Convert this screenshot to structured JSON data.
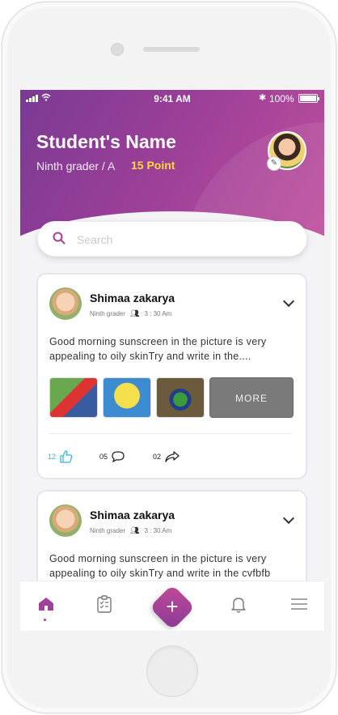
{
  "status_bar": {
    "time": "9:41 AM",
    "battery": "100%"
  },
  "profile": {
    "name": "Student's Name",
    "grade": "Ninth grader / A",
    "points": "15 Point"
  },
  "search": {
    "placeholder": "Search"
  },
  "posts": [
    {
      "author": "Shimaa zakarya",
      "grade": "Ninth grader",
      "time": "3 : 30 Am",
      "text": "Good morning sunscreen in the picture is very appealing to oily skinTry and write in the....",
      "more_label": "MORE",
      "likes": "12",
      "comments": "05",
      "shares": "02"
    },
    {
      "author": "Shimaa zakarya",
      "grade": "Ninth grader",
      "time": "3 : 30 Am",
      "text": "Good morning sunscreen in the picture is very appealing to oily skinTry and write in the cvfbfb"
    }
  ],
  "colors": {
    "accent": "#a23f96",
    "points": "#ffd93a",
    "like": "#39b5d8"
  },
  "tabbar": {
    "items": [
      "home-icon",
      "tasks-icon",
      "add-icon",
      "bell-icon",
      "menu-icon"
    ],
    "fab_symbol": "+"
  }
}
